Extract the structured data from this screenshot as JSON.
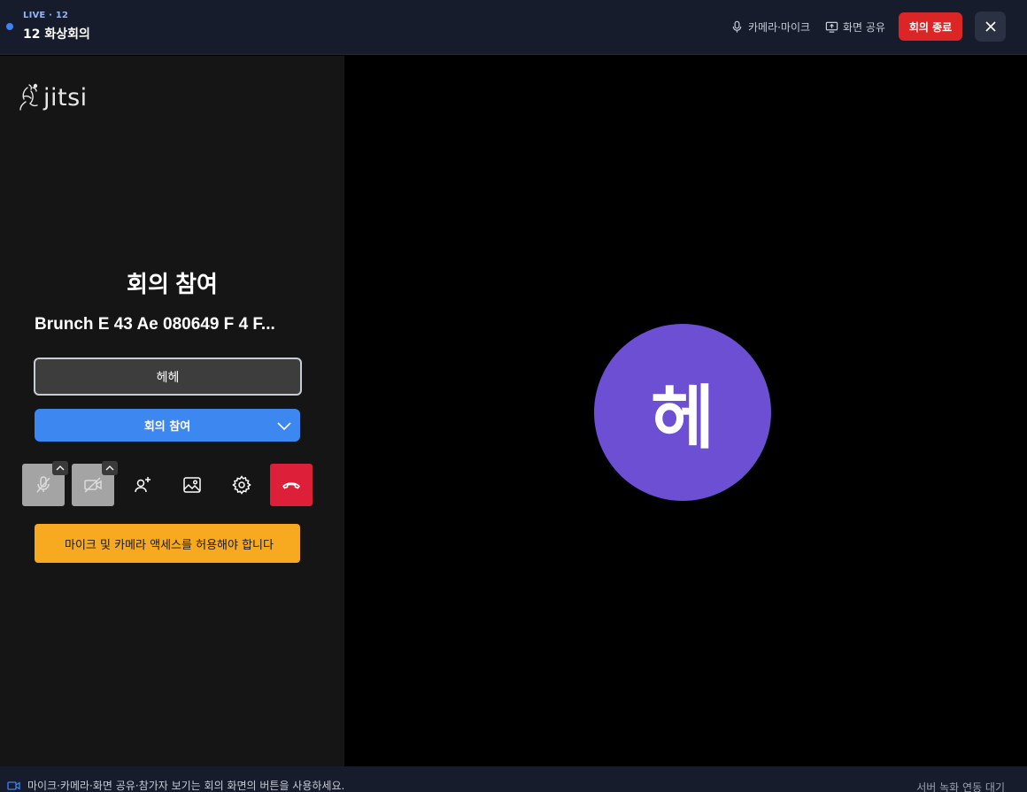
{
  "header": {
    "live_label": "LIVE · 12",
    "title": "12 화상회의",
    "camera_mic_label": "카메라·마이크",
    "screen_share_label": "화면 공유",
    "end_button_label": "회의 종료"
  },
  "prejoin": {
    "logo_text": "jitsi",
    "title": "회의 참여",
    "room_name": "Brunch E 43 Ae 080649 F 4 F...",
    "name_value": "헤헤",
    "join_button_label": "회의 참여",
    "warning_text": "마이크 및 카메라 액세스를 허용해야 합니다"
  },
  "stage": {
    "avatar_initial": "헤",
    "avatar_color": "#6c4fd3"
  },
  "footer": {
    "hint": "마이크·카메라·화면 공유·참가자 보기는 회의 화면의 버튼을 사용하세요.",
    "status": "서버 녹화 연동 대기"
  },
  "colors": {
    "accent": "#3d87f0",
    "danger": "#dc2626",
    "warning": "#f7aa1f",
    "live": "#3b82f6"
  }
}
